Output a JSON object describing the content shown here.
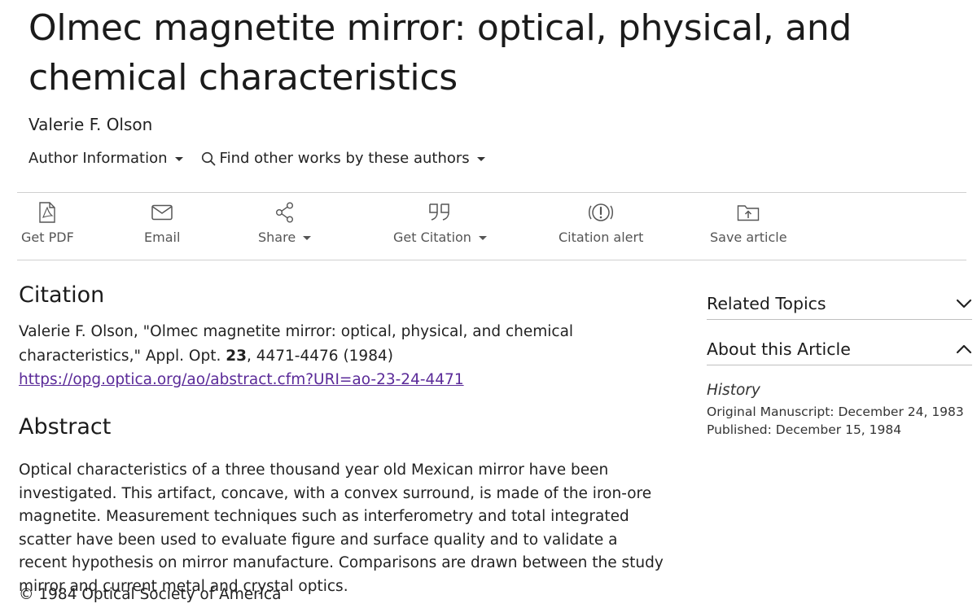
{
  "article": {
    "title": "Olmec magnetite mirror: optical, physical, and chemical characteristics",
    "authors": "Valerie F. Olson",
    "author_info_label": "Author Information",
    "find_works_label": "Find other works by these authors"
  },
  "toolbar": {
    "get_pdf": "Get PDF",
    "email": "Email",
    "share": "Share",
    "get_citation": "Get Citation",
    "citation_alert": "Citation alert",
    "save_article": "Save article"
  },
  "citation": {
    "heading": "Citation",
    "text_prefix": "Valerie F. Olson, \"Olmec magnetite mirror: optical, physical, and chemical characteristics,\" Appl. Opt. ",
    "volume": "23",
    "text_suffix": ", 4471-4476 (1984)",
    "url": "https://opg.optica.org/ao/abstract.cfm?URI=ao-23-24-4471"
  },
  "abstract": {
    "heading": "Abstract",
    "text": "Optical characteristics of a three thousand year old Mexican mirror have been investigated. This artifact, concave, with a convex surround, is made of the iron-ore magnetite. Measurement techniques such as interferometry and total integrated scatter have been used to evaluate figure and surface quality and to validate a recent hypothesis on mirror manufacture. Comparisons are drawn between the study mirror and current metal and crystal optics.",
    "copyright": "© 1984 Optical Society of America"
  },
  "sidebar": {
    "related_topics": "Related Topics",
    "about_article": "About this Article",
    "history_label": "History",
    "original_manuscript": "Original Manuscript: December 24, 1983",
    "published": "Published: December 15, 1984"
  },
  "icons": {
    "pdf": "pdf-file-icon",
    "email": "envelope-icon",
    "share": "share-icon",
    "citation": "quote-icon",
    "alert": "alert-icon",
    "save": "folder-upload-icon"
  }
}
